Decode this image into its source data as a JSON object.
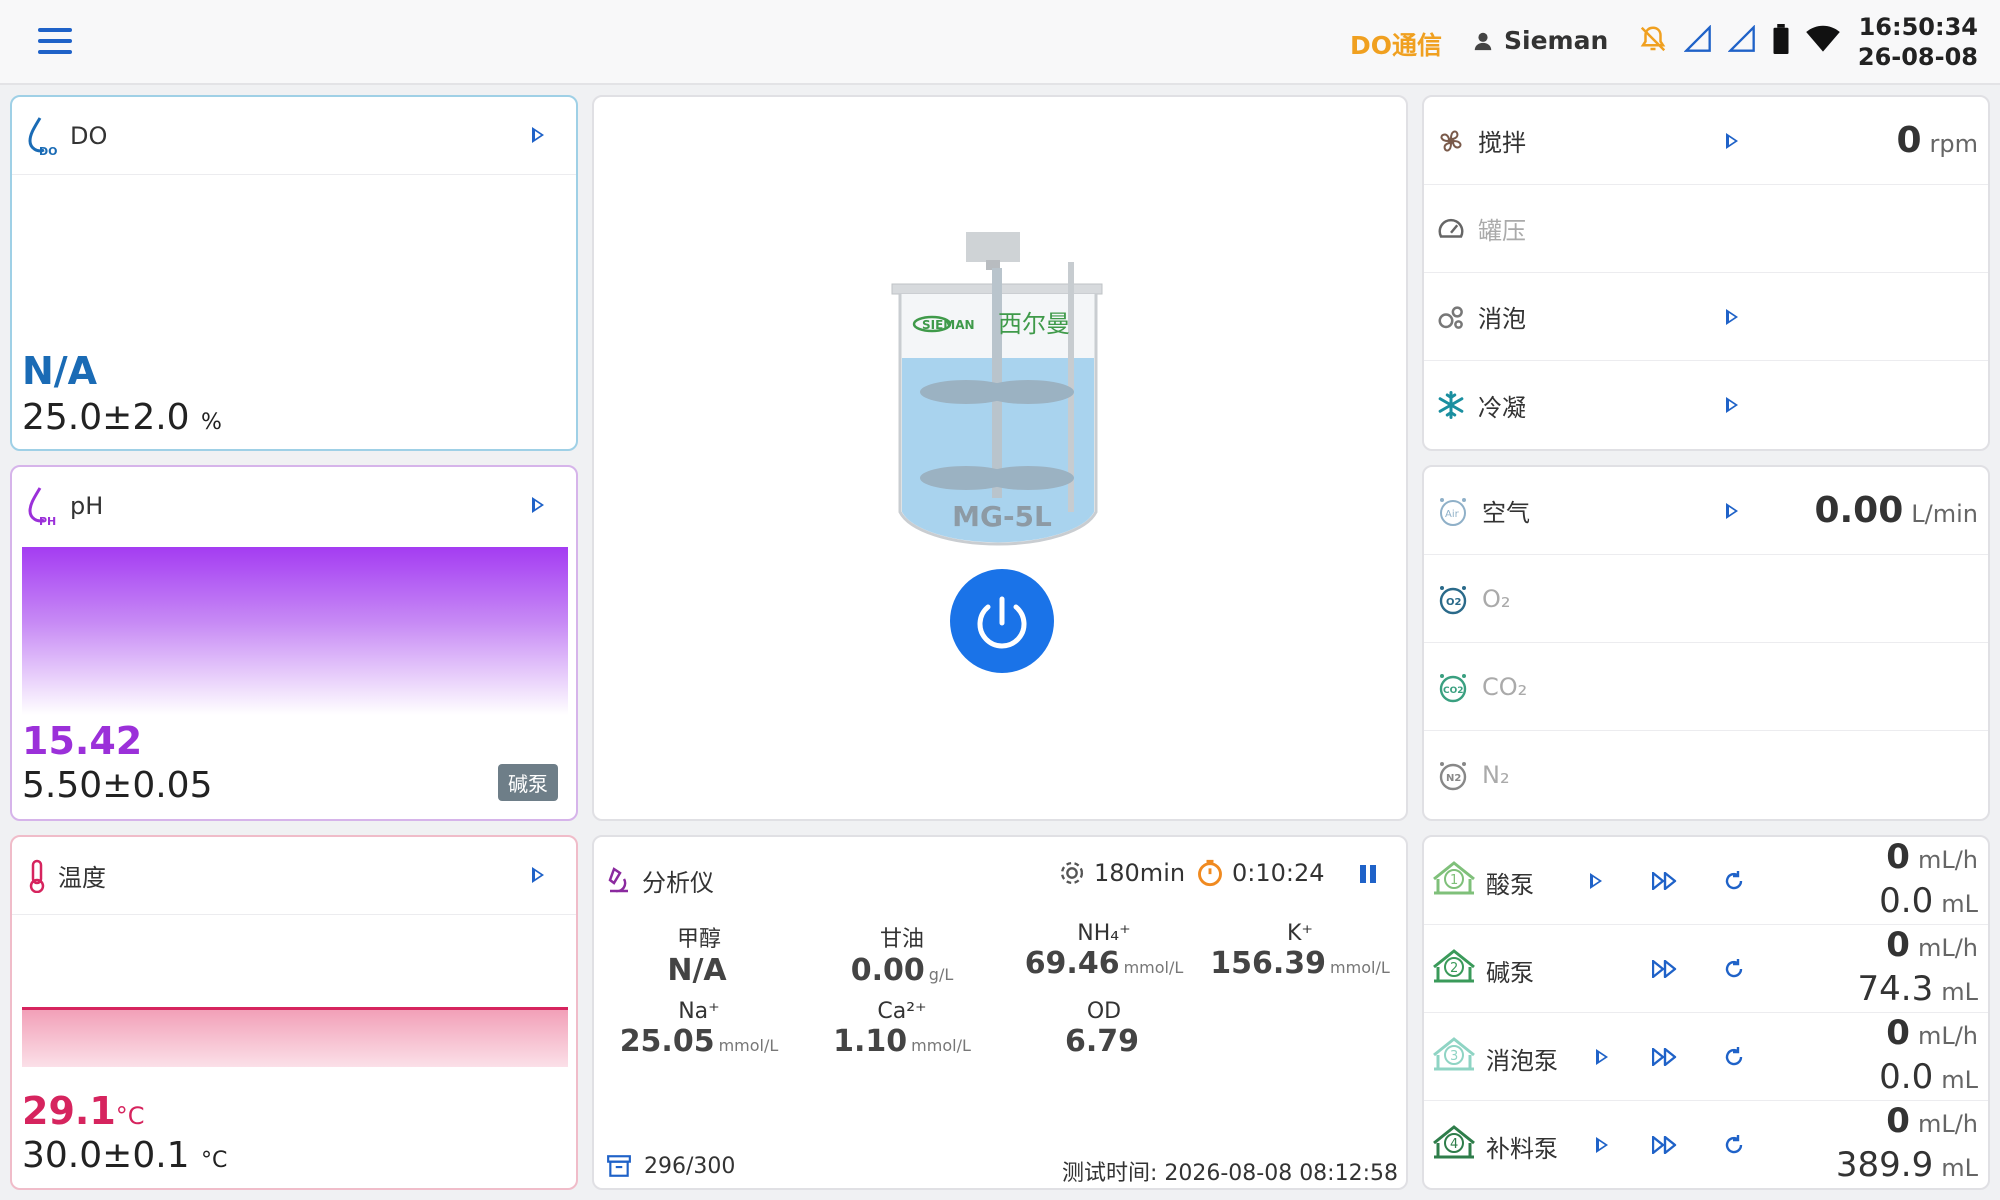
{
  "topbar": {
    "comm_status": "DO通信",
    "user": "Sieman",
    "time": "16:50:34",
    "date": "26-08-08",
    "icons": [
      "menu-icon",
      "user-icon",
      "bell-off-icon",
      "signal-icon",
      "signal-icon",
      "battery-icon",
      "wifi-icon"
    ]
  },
  "do_card": {
    "title": "DO",
    "icon_text": "DO",
    "value": "N/A",
    "setpoint": "25.0±2.0",
    "unit": "%"
  },
  "ph_card": {
    "title": "pH",
    "icon_text": "PH",
    "value": "15.42",
    "setpoint": "5.50±0.05",
    "badge": "碱泵"
  },
  "temp_card": {
    "title": "温度",
    "value": "29.1",
    "value_unit": "°C",
    "setpoint": "30.0±0.1",
    "unit": "°C"
  },
  "vessel": {
    "brand_logo": "SIEMAN",
    "brand_cn": "西尔曼",
    "model": "MG-5L"
  },
  "right_top": {
    "rows": [
      {
        "label": "搅拌",
        "value": "0",
        "unit": "rpm",
        "icon": "fan-icon",
        "active": true
      },
      {
        "label": "罐压",
        "value": "",
        "unit": "",
        "icon": "gauge-icon",
        "active": false
      },
      {
        "label": "消泡",
        "value": "",
        "unit": "",
        "icon": "bubbles-icon",
        "active": true
      },
      {
        "label": "冷凝",
        "value": "",
        "unit": "",
        "icon": "snowflake-icon",
        "active": true
      }
    ]
  },
  "right_mid": {
    "rows": [
      {
        "label": "空气",
        "icon_text": "Air",
        "value": "0.00",
        "unit": "L/min",
        "active": true
      },
      {
        "label": "O₂",
        "icon_text": "O2",
        "value": "",
        "unit": "",
        "active": false
      },
      {
        "label": "CO₂",
        "icon_text": "CO2",
        "value": "",
        "unit": "",
        "active": false
      },
      {
        "label": "N₂",
        "icon_text": "N2",
        "value": "",
        "unit": "",
        "active": false
      }
    ]
  },
  "analyzer": {
    "title": "分析仪",
    "interval": "180min",
    "timer": "0:10:24",
    "count": "296/300",
    "test_time": "测试时间: 2026-08-08 08:12:58",
    "items": [
      {
        "name": "甲醇",
        "value": "N/A",
        "unit": ""
      },
      {
        "name": "甘油",
        "value": "0.00",
        "unit": "g/L"
      },
      {
        "name": "NH₄⁺",
        "value": "69.46",
        "unit": "mmol/L"
      },
      {
        "name": "K⁺",
        "value": "156.39",
        "unit": "mmol/L"
      },
      {
        "name": "Na⁺",
        "value": "25.05",
        "unit": "mmol/L"
      },
      {
        "name": "Ca²⁺",
        "value": "1.10",
        "unit": "mmol/L"
      },
      {
        "name": "OD",
        "value": "6.79",
        "unit": ""
      }
    ]
  },
  "pumps": [
    {
      "label": "酸泵",
      "num": "1",
      "rate": "0",
      "rate_unit": "mL/h",
      "total": "0.0",
      "total_unit": "mL",
      "color": "#5aa55a"
    },
    {
      "label": "碱泵",
      "num": "2",
      "rate": "0",
      "rate_unit": "mL/h",
      "total": "74.3",
      "total_unit": "mL",
      "color": "#3a9a5a"
    },
    {
      "label": "消泡泵",
      "num": "3",
      "rate": "0",
      "rate_unit": "mL/h",
      "total": "0.0",
      "total_unit": "mL",
      "color": "#6cc0b0"
    },
    {
      "label": "补料泵",
      "num": "4",
      "rate": "0",
      "rate_unit": "mL/h",
      "total": "389.9",
      "total_unit": "mL",
      "color": "#2e7d4a"
    }
  ],
  "colors": {
    "accent": "#1f62c8",
    "do": "#1a6bb5",
    "ph": "#9b30d9",
    "temp": "#d6245e",
    "power": "#1a73e8",
    "comm": "#f0a020"
  }
}
